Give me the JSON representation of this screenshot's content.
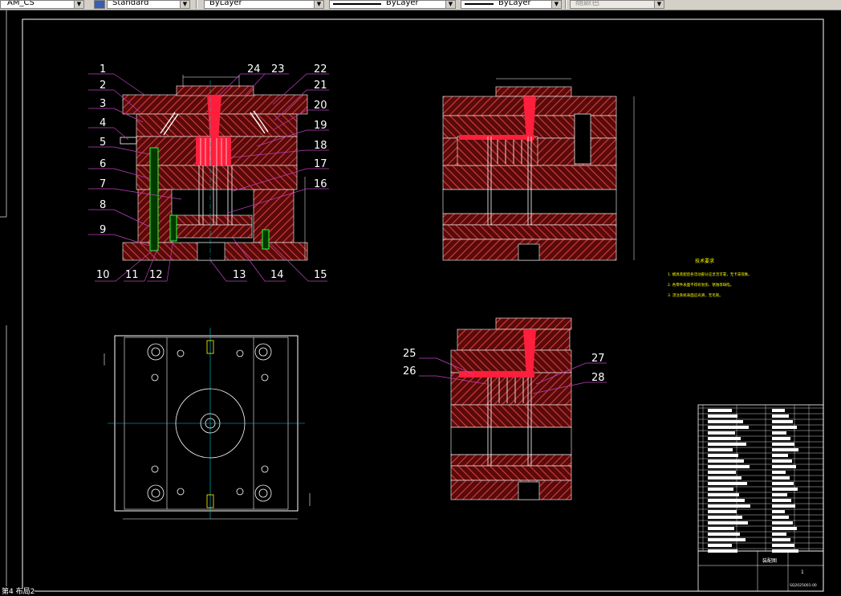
{
  "toolbar": {
    "text_style": "AM_CS",
    "dim_style": "Standard",
    "layer_color": "ByLayer",
    "linetype": "ByLayer",
    "lineweight": "ByLayer",
    "plot_style": "随颜色"
  },
  "callouts_left": [
    "1",
    "2",
    "3",
    "4",
    "5",
    "6",
    "7",
    "8",
    "9"
  ],
  "callouts_right": [
    "22",
    "21",
    "20",
    "19",
    "18",
    "17",
    "16"
  ],
  "callouts_top": [
    "24",
    "23"
  ],
  "callouts_bottom": [
    "10",
    "11",
    "12",
    "13",
    "14",
    "15"
  ],
  "callouts_section": [
    "25",
    "26",
    "27",
    "28"
  ],
  "notes": {
    "title": "技术要求",
    "lines": [
      "1. 模具装配后各活动部分应灵活可靠，无卡滞现象。",
      "2. 各零件表面不得有划伤、锈蚀等缺陷。",
      "3. 浇注系统表面应光滑，无毛刺。"
    ]
  },
  "title_block": {
    "drawing_name": "装配图",
    "sheet": "1",
    "drawing_no": "SQ2025001-00"
  },
  "status": "第4 布局2"
}
